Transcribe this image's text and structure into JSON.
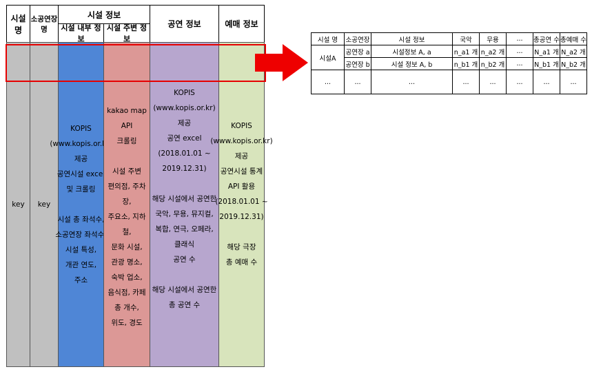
{
  "main_table": {
    "headers": {
      "facility_name": "시설 명",
      "small_theater_name": "소공연장명",
      "facility_info": "시설 정보",
      "internal_info": "시설 내부 정보",
      "surrounding_info": "시설 주변 정보",
      "performance_info": "공연 정보",
      "booking_info": "예매 정보"
    },
    "columns": {
      "facility_name": "key",
      "small_theater_name": "key",
      "internal_info": "KOPIS\n(www.kopis.or.kr)\n제공\n공연시설 excel\n및 크롤링\n\n시설 총 좌석수,\n소공연장 좌석수,\n시설 특성,\n개관 연도,\n주소",
      "surrounding_info": "kakao map API\n크롤링\n\n시설 주변\n편의점, 주차장,\n주요소, 지하철,\n문화 시설,\n관광 명소,\n숙박 업소,\n음식점, 카페\n총 개수,\n위도, 경도",
      "performance_info": "KOPIS\n(www.kopis.or.kr)\n제공\n공연 excel\n(2018.01.01 ~ 2019.12.31)\n\n해당 시설에서 공연한\n국악, 무용, 뮤지컬,\n복합, 연극, 오페라,\n클래식\n공연 수\n\n해당 시설에서 공연한\n총 공연 수",
      "booking_info": "KOPIS\n(www.kopis.or.kr)\n제공\n공연시설 통계\nAPI 활용\n(2018.01.01 ~\n2019.12.31)\n\n해당 극장\n총 예매 수"
    },
    "colors": {
      "key": "#c0c0c0",
      "internal": "#4f86d6",
      "surrounding": "#dc9896",
      "performance": "#b7a6ce",
      "booking": "#d8e4bc",
      "highlight": "#e60000",
      "arrow": "#ee0000"
    }
  },
  "result_table": {
    "headers": [
      "시설 명",
      "소공연장",
      "시설 정보",
      "국악",
      "무용",
      "...",
      "총공연 수",
      "총예매 수"
    ],
    "facility": "시설A",
    "rows": [
      [
        "공연장 a",
        "시설정보 A, a",
        "n_a1 개",
        "n_a2 개",
        "...",
        "N_a1 개",
        "N_a2 개"
      ],
      [
        "공연장 b",
        "시설 정보 A, b",
        "n_b1 개",
        "n_b2 개",
        "...",
        "N_b1 개",
        "N_b2 개"
      ]
    ],
    "ellipsis_row": [
      "...",
      "...",
      "...",
      "...",
      "...",
      "...",
      "...",
      "..."
    ]
  }
}
